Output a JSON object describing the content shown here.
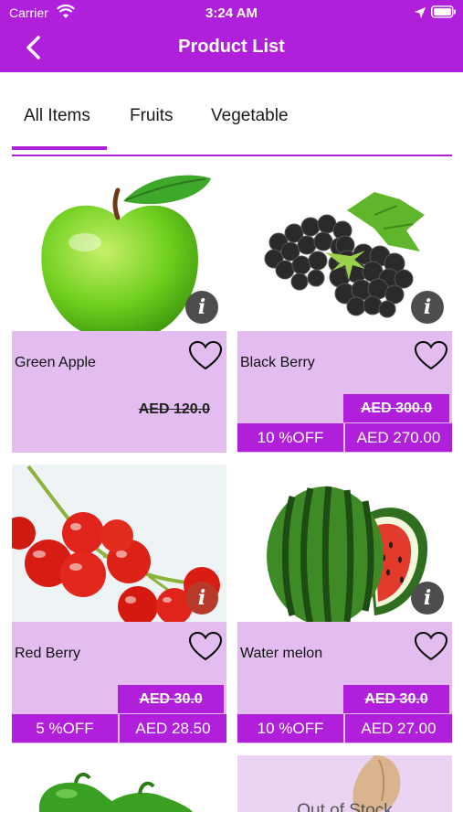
{
  "status_bar": {
    "carrier": "Carrier",
    "time": "3:24 AM"
  },
  "header": {
    "title": "Product List"
  },
  "tabs": [
    {
      "label": "All Items",
      "active": true
    },
    {
      "label": "Fruits",
      "active": false
    },
    {
      "label": "Vegetable",
      "active": false
    }
  ],
  "colors": {
    "accent": "#b01fd9",
    "card_panel": "#e3bdf0"
  },
  "products": [
    {
      "name": "Green Apple",
      "old_price": "AED 120.0",
      "image_icon": "green-apple"
    },
    {
      "name": "Black Berry",
      "old_price": "AED 300.0",
      "discount": "10 %OFF",
      "new_price": "AED 270.00",
      "image_icon": "blackberry"
    },
    {
      "name": "Red Berry",
      "old_price": "AED 30.0",
      "discount": "5 %OFF",
      "new_price": "AED 28.50",
      "image_icon": "red-currant"
    },
    {
      "name": "Water melon",
      "old_price": "AED 30.0",
      "discount": "10 %OFF",
      "new_price": "AED 27.00",
      "image_icon": "watermelon"
    },
    {
      "name": "",
      "image_icon": "green-pepper"
    },
    {
      "name": "",
      "stock_label": "Out of Stock",
      "image_icon": "ginger"
    }
  ],
  "icons": {
    "info": "i"
  }
}
